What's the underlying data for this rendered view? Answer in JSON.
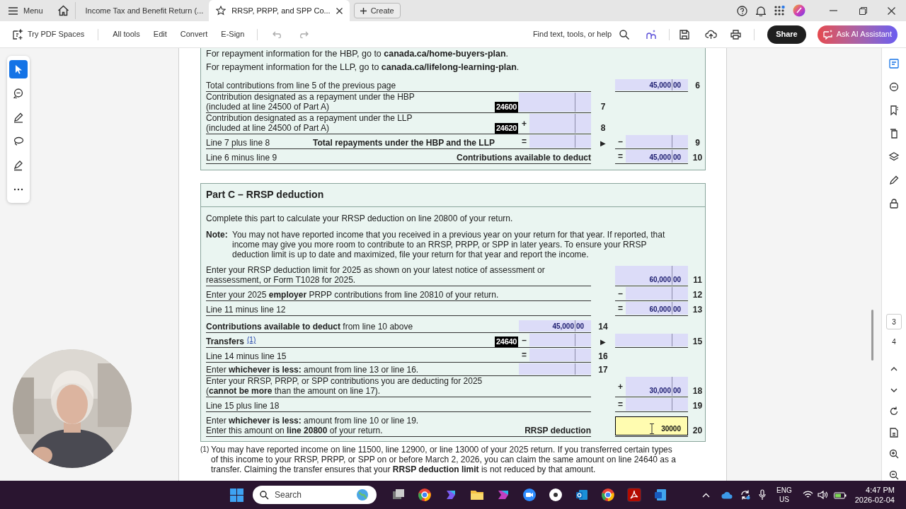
{
  "titlebar": {
    "menu_label": "Menu",
    "create_label": "Create"
  },
  "tabs": [
    {
      "label": "Income Tax and Benefit Return (...",
      "selected": false
    },
    {
      "label": "RRSP, PRPP, and SPP Co...",
      "selected": true
    }
  ],
  "toolbar": {
    "spaces_label": "Try PDF Spaces",
    "items": [
      "All tools",
      "Edit",
      "Convert",
      "E-Sign"
    ],
    "search_hint": "Find text, tools, or help",
    "share_label": "Share",
    "ai_label": "Ask AI Assistant"
  },
  "left_tools": [
    {
      "kind": "select",
      "selected": true
    },
    {
      "kind": "comment",
      "selected": false
    },
    {
      "kind": "draw",
      "selected": false
    },
    {
      "kind": "lasso",
      "selected": false
    },
    {
      "kind": "highlight",
      "selected": false
    },
    {
      "kind": "more",
      "selected": false
    }
  ],
  "section_b": {
    "info": [
      "For repayment information for the HBP, go to **canada.ca/home-buyers-plan**.",
      "For repayment information for the LLP, go to **canada.ca/lifelong-learning-plan**."
    ],
    "groups": [
      [
        {
          "text": [
            "Total contributions from line 5 of the previous page"
          ],
          "right": {
            "dollars": "45,000",
            "cents": "00",
            "line": "6"
          }
        },
        {
          "text": [
            "Contribution designated as a repayment under the HBP",
            "(included at line 24500 of Part A)"
          ],
          "code": "24600",
          "mid": {
            "line": "7"
          }
        },
        {
          "text": [
            "Contribution designated as a repayment under the LLP",
            "(included at line 24500 of Part A)"
          ],
          "code": "24620",
          "mid": {
            "op": "+",
            "line": "8"
          }
        },
        {
          "text": [
            "Line 7 plus line 8"
          ],
          "total": "Total repayments under the HBP and the LLP",
          "mid": {
            "op": "="
          },
          "arrow": "▶",
          "right": {
            "op": "–",
            "line": "9"
          }
        },
        {
          "text": [
            "Line 6 minus line 9"
          ],
          "total": "Contributions available to deduct",
          "right": {
            "op": "=",
            "dollars": "45,000",
            "cents": "00",
            "line": "10"
          }
        }
      ]
    ]
  },
  "section_c": {
    "title": "Part C – RRSP deduction",
    "intro": "Complete this part to calculate your RRSP deduction on line 20800 of your return.",
    "note_label": "Note:",
    "note": "You may not have reported income that you received in a previous year on your return for that year. If reported, that income may give you more room to contribute to an RRSP, PRPP, or SPP in later years. To ensure your RRSP deduction limit is up to date and maximized, file your return for that year and report the income.",
    "groups": [
      [
        {
          "text": [
            "Enter your RRSP deduction limit for 2025 as shown on your latest notice of assessment or",
            "reassessment, or Form T1028 for 2025."
          ],
          "right": {
            "dollars": "60,000",
            "cents": "00",
            "line": "11"
          }
        },
        {
          "text": [
            "Enter your 2025 **employer** PRPP contributions from line 20810 of your return."
          ],
          "right": {
            "op": "–",
            "line": "12"
          }
        },
        {
          "text": [
            "Line 11 minus line 12"
          ],
          "right": {
            "op": "=",
            "dollars": "60,000",
            "cents": "00",
            "line": "13"
          }
        }
      ],
      [
        {
          "text": [
            "**Contributions available to deduct** from line 10 above"
          ],
          "mid": {
            "dollars": "45,000",
            "cents": "00",
            "line": "14"
          }
        },
        {
          "text": [
            "Transfers"
          ],
          "bold": true,
          "note_ref": "(1)",
          "code": "24640",
          "mid": {
            "op": "–"
          },
          "arrow": "▶",
          "right": {
            "line": "15"
          }
        },
        {
          "text": [
            "Line 14 minus line 15"
          ],
          "mid": {
            "op": "=",
            "line": "16"
          }
        },
        {
          "text": [
            "Enter **whichever is less:** amount from line 13 or line 16."
          ],
          "mid": {
            "line": "17"
          }
        },
        {
          "text": [
            "Enter your RRSP, PRPP, or SPP contributions you are deducting for 2025",
            "(**cannot be more** than the amount on line 17)."
          ],
          "right": {
            "op": "+",
            "dollars": "30,000",
            "cents": "00",
            "line": "18"
          }
        },
        {
          "text": [
            "Line 15 plus line 18"
          ],
          "right": {
            "op": "=",
            "line": "19"
          }
        }
      ],
      [
        {
          "text": [
            "Enter **whichever is less:** amount from line 10 or line 19.",
            "Enter this amount on **line 20800** of your return."
          ],
          "total": "RRSP deduction",
          "right": {
            "value": "30000",
            "focused": true,
            "line": "20"
          }
        }
      ]
    ]
  },
  "footnote": {
    "marker": "(1)",
    "text": "You may have reported income on line 11500, line 12900, or line 13000 of your 2025 return. If you transferred certain types of this income to your RRSP, PRPP, or SPP on or before March 2, 2026, you can claim the same amount on line 24640 as a transfer. Claiming the transfer ensures that your **RRSP deduction limit** is not reduced by that amount."
  },
  "page_nav": [
    {
      "label": "3",
      "selected": true
    },
    {
      "label": "4",
      "selected": false
    }
  ],
  "taskbar": {
    "search_label": "Search",
    "lang": "ENG",
    "region": "US",
    "time": "4:47 PM",
    "date": "2026-02-04"
  }
}
